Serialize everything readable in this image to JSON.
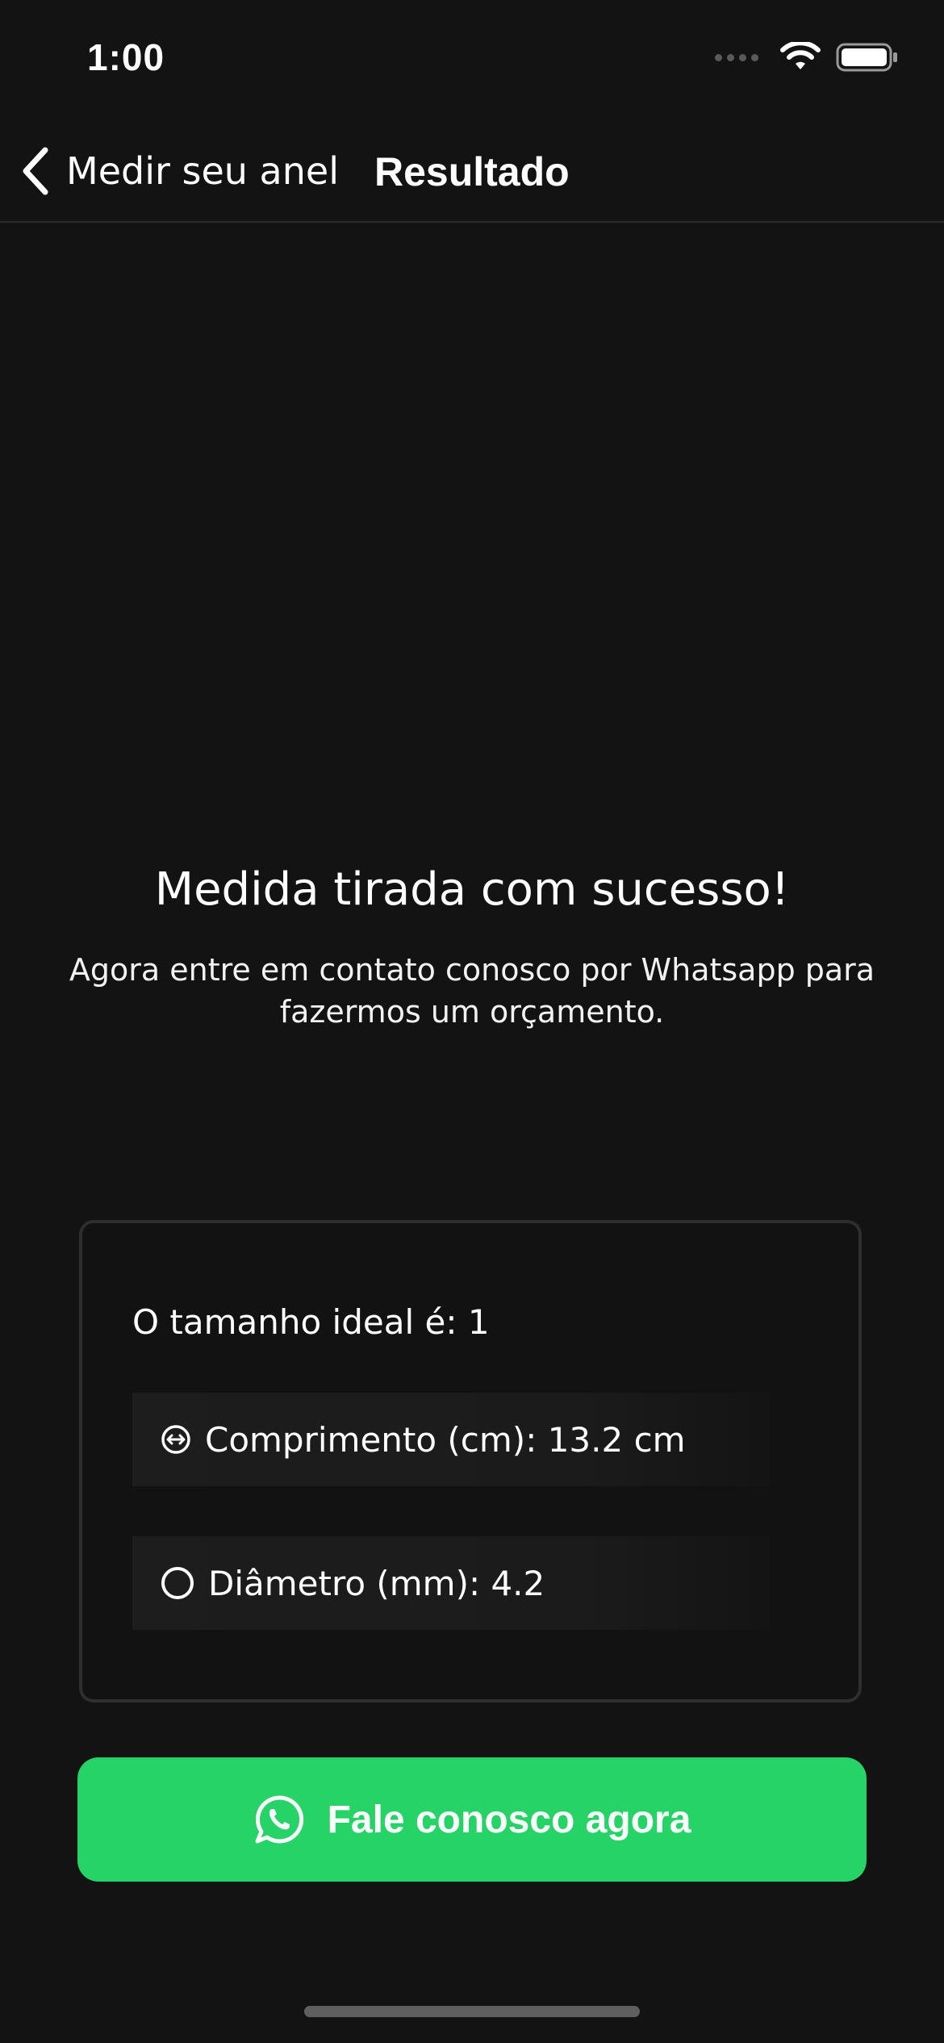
{
  "status_bar": {
    "time": "1:00"
  },
  "nav": {
    "back_label": "Medir seu anel",
    "title": "Resultado"
  },
  "content": {
    "headline": "Medida tirada com sucesso!",
    "subtext": "Agora entre em contato conosco por Whatsapp para fazermos um orçamento."
  },
  "result": {
    "ideal_size": "O tamanho ideal é: 1",
    "length": "Comprimento (cm): 13.2 cm",
    "diameter": "Diâmetro (mm): 4.2"
  },
  "cta": {
    "label": "Fale conosco agora"
  },
  "icons": {
    "back": "chevron-left-icon",
    "wifi": "wifi-icon",
    "battery": "battery-icon",
    "length": "horizontal-arrow-circle-icon",
    "diameter": "circle-icon",
    "whatsapp": "whatsapp-icon"
  },
  "colors": {
    "background": "#131313",
    "accent": "#25d366",
    "card_border": "#2e2e2e"
  }
}
